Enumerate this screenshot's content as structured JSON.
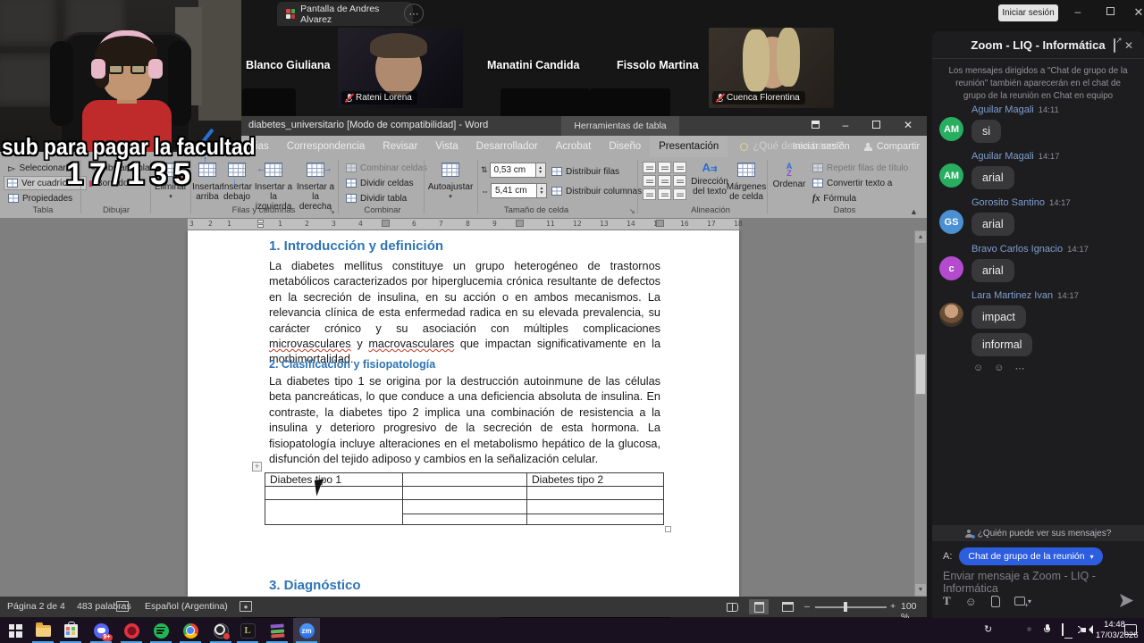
{
  "overlay": {
    "caption": "sub para pagar la facultad",
    "counter": "17/135"
  },
  "meeting": {
    "tab_label": "Pantalla de Andres Alvarez",
    "more_label": "⋯",
    "signin_label": "Iniciar sesión",
    "minimize": "–",
    "tiles": {
      "name1": "Blanco Giuliana",
      "label1": "co Giuliana",
      "label2": "Rateni Lorena",
      "name3": "Manatini Candida",
      "label3": "Manatini Candida",
      "name4": "Fissolo Martina",
      "label4": "Fissolo Martina",
      "label5": "Cuenca Florentina"
    }
  },
  "word": {
    "title": "diabetes_universitario [Modo de compatibilidad] - Word",
    "context_title": "Herramientas de tabla",
    "tabs": [
      "ias",
      "Correspondencia",
      "Revisar",
      "Vista",
      "Desarrollador",
      "Acrobat",
      "Diseño",
      "Presentación"
    ],
    "tell_me": "¿Qué desea hacer?",
    "signin": "Iniciar sesión",
    "share": "Compartir",
    "ribbon": {
      "tabla": {
        "label": "Tabla",
        "select": "Seleccionar",
        "grid": "Ver cuadrículas",
        "props": "Propiedades"
      },
      "dibujar": {
        "label": "Dibujar",
        "draw": "Dibujar tabla",
        "eraser": "Borrador"
      },
      "eliminar": "Eliminar",
      "filas": {
        "label": "Filas y columnas",
        "b1a": "Insertar",
        "b1b": "arriba",
        "b2a": "Insertar",
        "b2b": "debajo",
        "b3a": "Insertar a",
        "b3b": "la izquierda",
        "b4a": "Insertar a",
        "b4b": "la derecha"
      },
      "combinar": {
        "label": "Combinar",
        "merge": "Combinar celdas",
        "split": "Dividir celdas",
        "split_table": "Dividir tabla"
      },
      "autofit": "Autoajustar",
      "tamano": {
        "label": "Tamaño de celda",
        "height": "0,53 cm",
        "width": "5,41 cm",
        "rows": "Distribuir filas",
        "cols": "Distribuir columnas"
      },
      "alineacion": {
        "label": "Alineación",
        "dir1": "Dirección",
        "dir2": "del texto",
        "mar1": "Márgenes",
        "mar2": "de celda"
      },
      "datos": {
        "label": "Datos",
        "sort": "Ordenar",
        "repeat": "Repetir filas de título",
        "convert": "Convertir texto a",
        "formula": "Fórmula"
      }
    },
    "ruler": {
      "left": [
        "3",
        "2",
        "1"
      ],
      "right": [
        "1",
        "2",
        "3",
        "4",
        "6",
        "7",
        "8",
        "9",
        "11",
        "12",
        "13",
        "14",
        "15",
        "16",
        "17",
        "18"
      ]
    },
    "document": {
      "h1": "1. Introducción y definición",
      "p1a": "La diabetes mellitus constituye un grupo heterogéneo de trastornos metabólicos caracterizados por hiperglucemia crónica resultante de defectos en la secreción de insulina, en su acción o en ambos mecanismos. La relevancia clínica de esta enfermedad radica en su elevada prevalencia, su carácter crónico y su asociación con múltiples complicaciones ",
      "p1b": "microvasculares",
      "p1c": " y ",
      "p1d": "macrovasculares",
      "p1e": " que impactan significativamente en la morbimortalidad.",
      "h2": "2. Clasificación y fisiopatología",
      "p2": "La diabetes tipo 1 se origina por la destrucción autoinmune de las células beta pancreáticas, lo que conduce a una deficiencia absoluta de insulina. En contraste, la diabetes tipo 2 implica una combinación de resistencia a la insulina y deterioro progresivo de la secreción de esta hormona. La fisiopatología incluye alteraciones en el metabolismo hepático de la glucosa, disfunción del tejido adiposo y cambios en la señalización celular.",
      "table_h1": "Diabetes tipo 1",
      "table_h3": "Diabetes tipo 2",
      "h3": "3. Diagnóstico"
    },
    "statusbar": {
      "page": "Página 2 de 4",
      "words": "483 palabras",
      "lang": "Español (Argentina)",
      "zoom": "100 %"
    }
  },
  "chat": {
    "title": "Zoom - LIQ - Informática",
    "notice": "Los mensajes dirigidos a \"Chat de grupo de la reunión\" también aparecerán en el chat de grupo de la reunión en Chat en equipo",
    "messages": [
      {
        "name": "Aguilar Magali",
        "time": "14:11",
        "initials": "AM",
        "color": "#27ae60",
        "texts": [
          "si"
        ]
      },
      {
        "name": "Aguilar Magali",
        "time": "14:17",
        "initials": "AM",
        "color": "#27ae60",
        "texts": [
          "arial"
        ]
      },
      {
        "name": "Gorosito Santino",
        "time": "14:17",
        "initials": "GS",
        "color": "#4a90d2",
        "texts": [
          "arial"
        ]
      },
      {
        "name": "Bravo Carlos Ignacio",
        "time": "14:17",
        "initials": "c",
        "color": "#b44bcf",
        "texts": [
          "arial"
        ]
      },
      {
        "name": "Lara Martinez Ivan",
        "time": "14:17",
        "initials": "",
        "color": "photo",
        "texts": [
          "impact",
          "informal"
        ],
        "reactions": true
      }
    ],
    "who_can_see": "¿Quién puede ver sus mensajes?",
    "to_label": "A:",
    "to_value": "Chat de grupo de la reunión",
    "placeholder": "Enviar mensaje a Zoom - LIQ - Informática"
  },
  "taskbar": {
    "icons": [
      "start",
      "file-explorer",
      "microsoft-store",
      "discord",
      "opera-gx",
      "spotify",
      "chrome",
      "obs-studio",
      "league-of-legends",
      "winrar",
      "zoom"
    ],
    "labels": {
      "zoom": "zm",
      "league-of-legends": "L"
    },
    "badge": "9+",
    "tray": [
      "restore-icon",
      "record-icon",
      "steam-icon",
      "mic-icon",
      "network-icon",
      "volume-icon"
    ],
    "time": "14:48",
    "date": "17/03/2026"
  }
}
